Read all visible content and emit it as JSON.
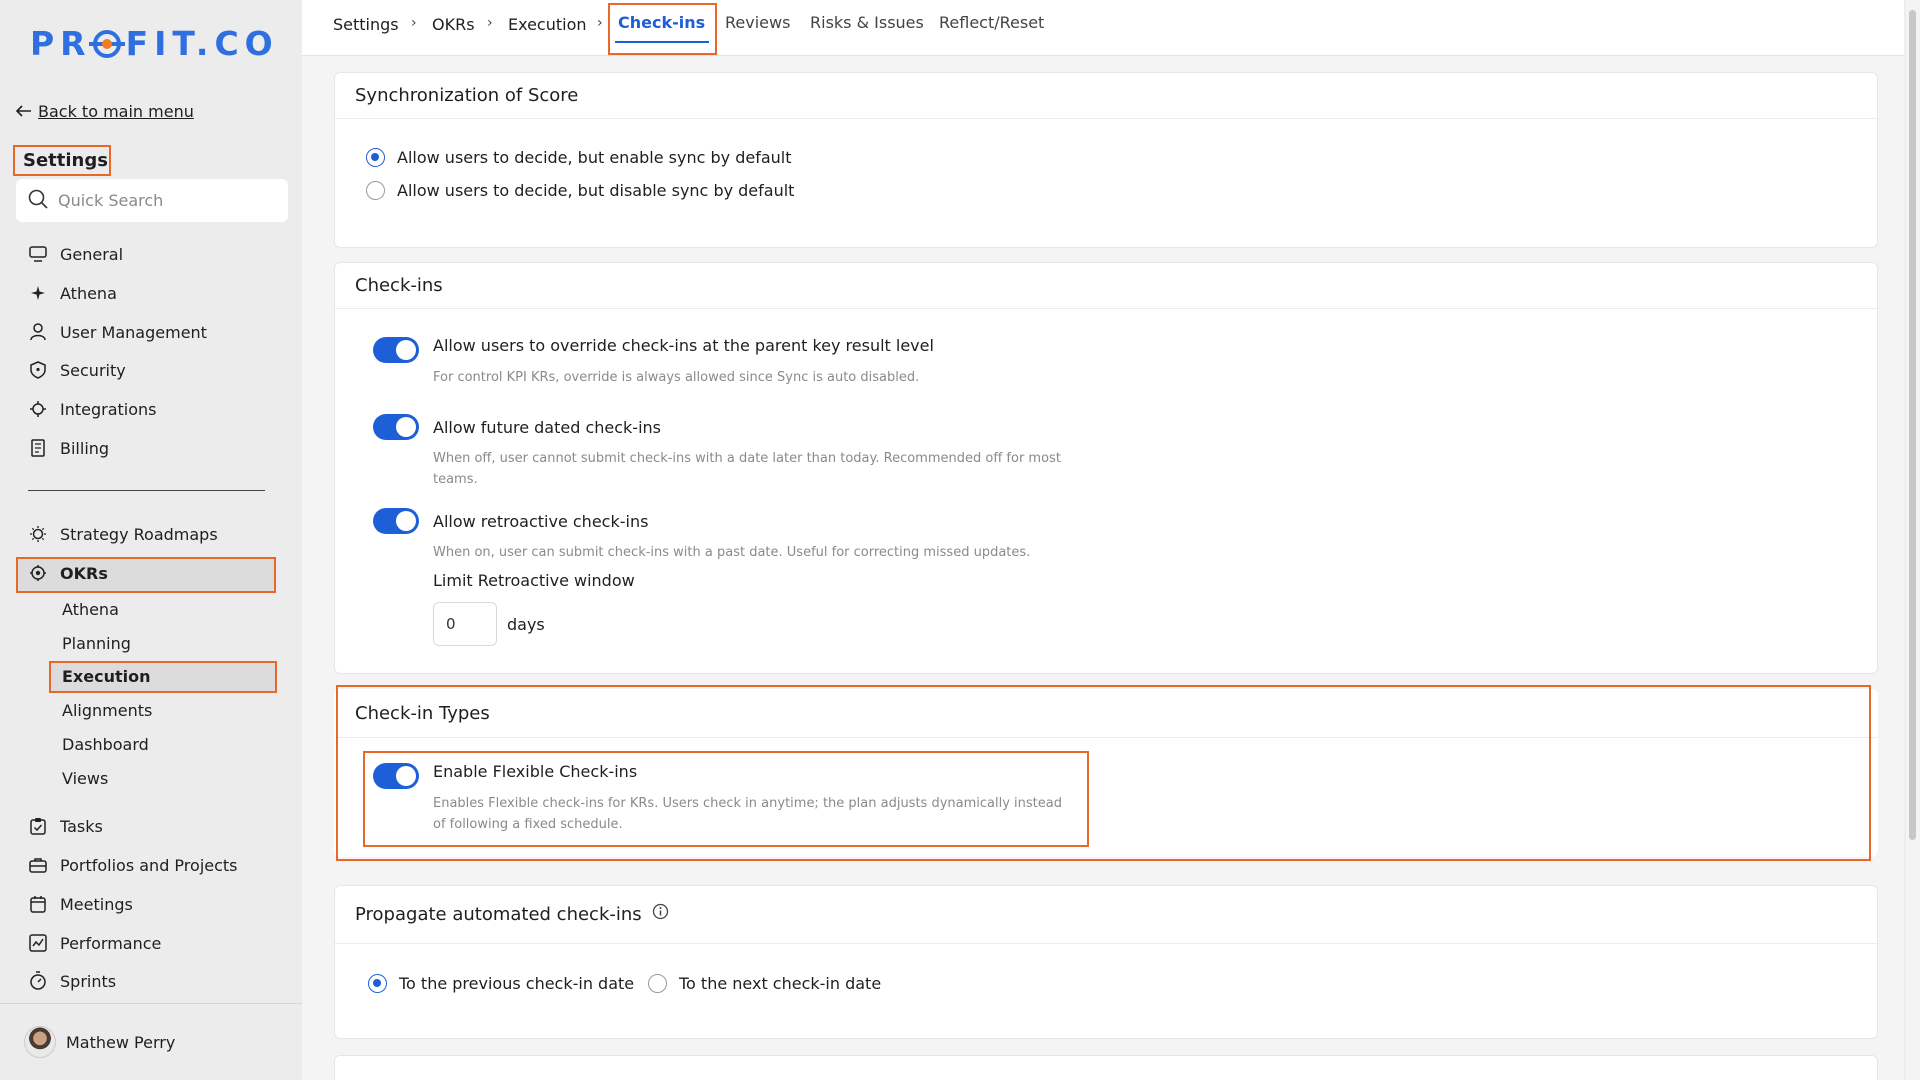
{
  "brand": {
    "logo_text_a": "PR",
    "logo_text_b": "FIT.CO"
  },
  "sidebar": {
    "back_label": "Back to main menu",
    "title": "Settings",
    "search_placeholder": "Quick Search",
    "items": [
      {
        "label": "General",
        "icon": "monitor-icon"
      },
      {
        "label": "Athena",
        "icon": "sparkle-icon"
      },
      {
        "label": "User Management",
        "icon": "user-icon"
      },
      {
        "label": "Security",
        "icon": "shield-icon"
      },
      {
        "label": "Integrations",
        "icon": "integrations-icon"
      },
      {
        "label": "Billing",
        "icon": "receipt-icon"
      }
    ],
    "items2": [
      {
        "label": "Strategy Roadmaps",
        "icon": "bulb-icon"
      },
      {
        "label": "OKRs",
        "icon": "target-icon"
      }
    ],
    "okr_sub": [
      "Athena",
      "Planning",
      "Execution",
      "Alignments",
      "Dashboard",
      "Views"
    ],
    "items3": [
      {
        "label": "Tasks",
        "icon": "clipboard-icon"
      },
      {
        "label": "Portfolios and Projects",
        "icon": "briefcase-icon"
      },
      {
        "label": "Meetings",
        "icon": "calendar-icon"
      },
      {
        "label": "Performance",
        "icon": "chart-icon"
      },
      {
        "label": "Sprints",
        "icon": "stopwatch-icon"
      }
    ],
    "user_name": "Mathew Perry"
  },
  "breadcrumb": [
    "Settings",
    "OKRs",
    "Execution"
  ],
  "tabs": {
    "active": "Check-ins",
    "others": [
      "Reviews",
      "Risks & Issues",
      "Reflect/Reset"
    ]
  },
  "sync_card": {
    "title": "Synchronization of Score",
    "options": [
      {
        "label": "Allow users to decide, but enable sync by default",
        "selected": true
      },
      {
        "label": "Allow users to decide, but disable sync by default",
        "selected": false
      }
    ]
  },
  "checkins_card": {
    "title": "Check-ins",
    "options": [
      {
        "title": "Allow users to override check-ins at the parent key result level",
        "desc": "For control KPI KRs, override is always allowed since Sync is auto disabled.",
        "enabled": true
      },
      {
        "title": "Allow future dated check-ins",
        "desc": "When off, user cannot submit check-ins with a date later than today. Recommended off for most teams.",
        "enabled": true
      },
      {
        "title": "Allow retroactive check-ins",
        "desc": "When on, user can submit check-ins with a past date. Useful for correcting missed updates.",
        "enabled": true
      }
    ],
    "limit_label": "Limit Retroactive window",
    "limit_value": "0",
    "limit_unit": "days"
  },
  "types_card": {
    "title": "Check-in Types",
    "option": {
      "title": "Enable Flexible Check-ins",
      "desc": "Enables Flexible check-ins for KRs. Users check in anytime; the plan adjusts dynamically instead of following a fixed schedule.",
      "enabled": true
    }
  },
  "propagate_card": {
    "title": "Propagate automated check-ins",
    "options": [
      {
        "label": "To the previous check-in date",
        "selected": true
      },
      {
        "label": "To the next check-in date",
        "selected": false
      }
    ]
  },
  "colors": {
    "accent": "#1d5fd6",
    "highlight": "#e8682c",
    "brand_orange": "#f27c22"
  }
}
